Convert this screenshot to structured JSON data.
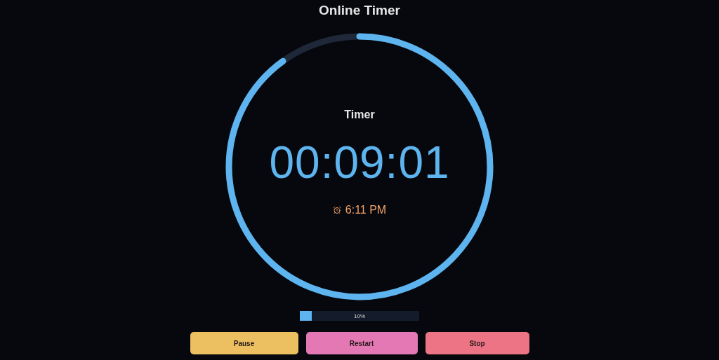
{
  "title": "Online Timer",
  "timer": {
    "label": "Timer",
    "time": "00:09:01",
    "alarm": "6:11 PM"
  },
  "progress": {
    "level": 0.1,
    "reading": "10%"
  },
  "buttons": [
    {
      "label": "Pause",
      "kind": "pause"
    },
    {
      "label": "Restart",
      "kind": "restart"
    },
    {
      "label": "Stop",
      "kind": "stop"
    }
  ]
}
